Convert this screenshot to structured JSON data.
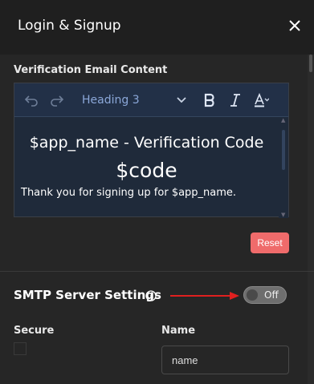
{
  "header": {
    "title": "Login & Signup"
  },
  "verification": {
    "section_label": "Verification Email Content",
    "toolbar": {
      "heading_select": "Heading 3"
    },
    "content": {
      "heading": "$app_name - Verification Code",
      "code": "$code",
      "paragraph": "Thank you for signing up for $app_name."
    },
    "reset_label": "Reset"
  },
  "smtp": {
    "title": "SMTP Server Settings",
    "toggle_label": "Off",
    "annotation_arrow_color": "#e0201f"
  },
  "fields": {
    "secure_label": "Secure",
    "name_label": "Name",
    "name_value": "name"
  },
  "colors": {
    "reset": "#ef6b6b",
    "editor_bg": "#1f2a3a",
    "header_bg": "#1f1f1f",
    "panel_bg": "#262626"
  },
  "icons": {
    "close": "close-icon",
    "undo": "undo-icon",
    "redo": "redo-icon",
    "bold": "bold-icon",
    "italic": "italic-icon",
    "text_color": "text-color-icon",
    "info": "info-icon"
  }
}
